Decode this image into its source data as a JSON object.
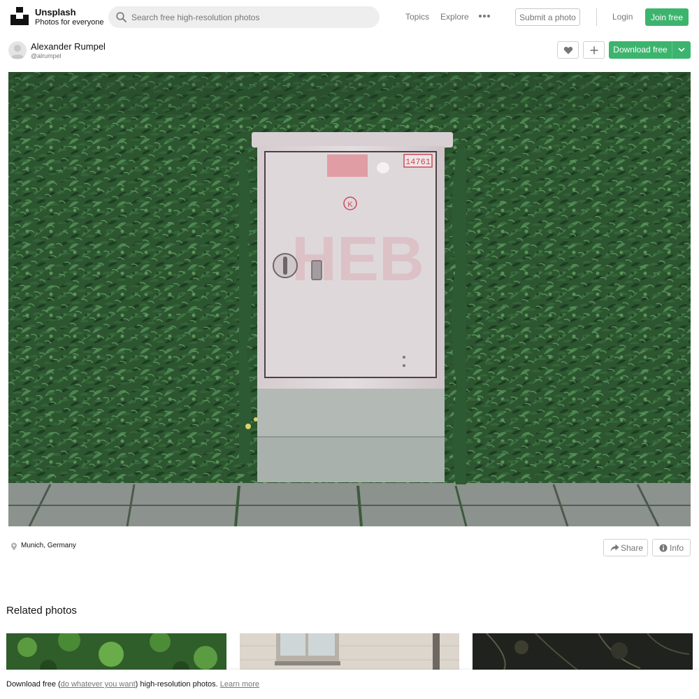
{
  "header": {
    "brand_name": "Unsplash",
    "brand_tagline": "Photos for everyone",
    "search_placeholder": "Search free high-resolution photos",
    "nav_topics": "Topics",
    "nav_explore": "Explore",
    "submit_label": "Submit a photo",
    "login_label": "Login",
    "join_label": "Join free"
  },
  "author": {
    "name": "Alexander Rumpel",
    "handle": "@alrumpel"
  },
  "actions": {
    "download_label": "Download free"
  },
  "photo": {
    "location": "Munich, Germany",
    "box_number": "14761",
    "share_label": "Share",
    "info_label": "Info"
  },
  "related": {
    "title": "Related photos"
  },
  "footer": {
    "prefix": "Download free (",
    "link_license": "do whatever you want",
    "middle": ") high-resolution photos. ",
    "link_learn": "Learn more"
  },
  "colors": {
    "accent_green": "#3cb46e",
    "hedge_green": "#2f5a33",
    "box_pink": "#dcd3d6",
    "text_gray": "#767676"
  }
}
